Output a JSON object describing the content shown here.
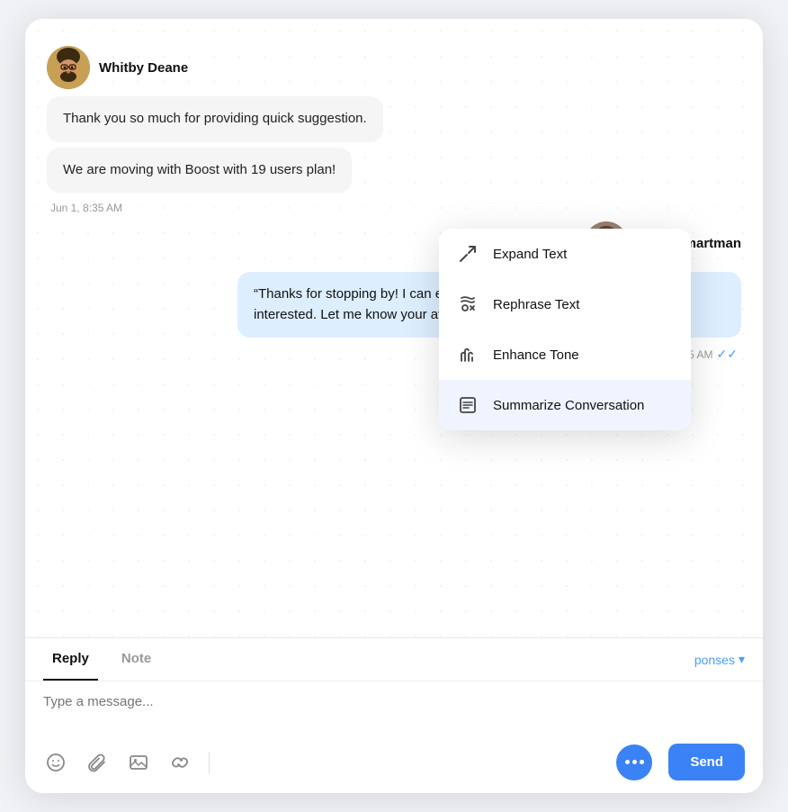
{
  "chat": {
    "incoming_user": {
      "name": "Whitby Deane",
      "avatar_emoji": "🧔"
    },
    "outgoing_user": {
      "name": "Conn Smartman",
      "avatar_emoji": "🧔"
    },
    "messages": [
      {
        "id": "msg1",
        "type": "incoming",
        "text": "Thank you so much for providing quick suggestion."
      },
      {
        "id": "msg2",
        "type": "incoming",
        "text": "We are moving with Boost with 19 users plan!"
      },
      {
        "id": "ts1",
        "type": "timestamp",
        "text": "Jun 1, 8:35 AM",
        "align": "left"
      },
      {
        "id": "msg3",
        "type": "outgoing",
        "text": "“Thanks for stopping by! I can explain installation steps for you, if you’re interested. Let me know your availability."
      },
      {
        "id": "ts2",
        "type": "timestamp",
        "text": "Jun 1, 8:35 AM",
        "align": "right"
      }
    ]
  },
  "dropdown": {
    "items": [
      {
        "id": "expand",
        "label": "Expand Text",
        "icon": "↗"
      },
      {
        "id": "rephrase",
        "label": "Rephrase Text",
        "icon": "✏"
      },
      {
        "id": "enhance",
        "label": "Enhance Tone",
        "icon": "♪"
      },
      {
        "id": "summarize",
        "label": "Summarize Conversation",
        "icon": "▤"
      }
    ]
  },
  "bottom_bar": {
    "tabs": [
      {
        "id": "reply",
        "label": "Reply",
        "active": true
      },
      {
        "id": "note",
        "label": "Note",
        "active": false
      }
    ],
    "canned_responses_label": "ponses",
    "canned_chevron": "▾",
    "input_placeholder": "Type a message...",
    "send_button_label": "Send"
  },
  "toolbar": {
    "icons": [
      {
        "name": "emoji",
        "symbol": "☺"
      },
      {
        "name": "attachment",
        "symbol": "📎"
      },
      {
        "name": "image",
        "symbol": "🖼"
      },
      {
        "name": "link",
        "symbol": "🔗"
      }
    ]
  }
}
